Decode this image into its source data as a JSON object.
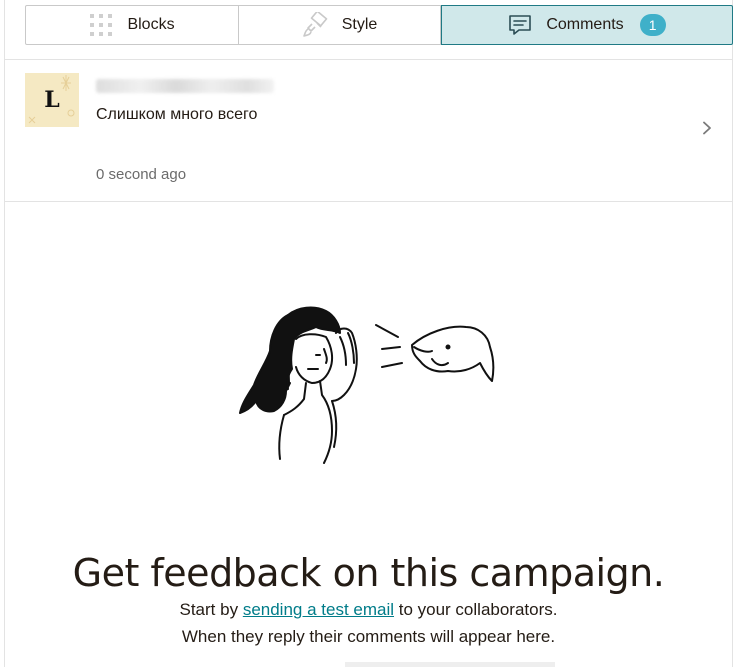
{
  "tabs": [
    {
      "label": "Blocks",
      "icon": "grid-dots-icon",
      "active": false
    },
    {
      "label": "Style",
      "icon": "paint-brush-icon",
      "active": false
    },
    {
      "label": "Comments",
      "icon": "comment-icon",
      "active": true,
      "badge": "1"
    }
  ],
  "comment": {
    "avatar_initial": "L",
    "text": "Слишком много всего",
    "time": "0 second ago",
    "chevron_icon": "chevron-right-icon"
  },
  "empty_state": {
    "illustration": "person-listening-to-dog-illustration",
    "title": "Get feedback on this campaign.",
    "line1_before": "Start by ",
    "line1_link": "sending a test email",
    "line1_after": " to your collaborators.",
    "line2": "When they reply their comments will appear here."
  },
  "colors": {
    "active_tab_bg": "#d0e8ea",
    "active_tab_border": "#1f7a85",
    "badge": "#3fb0c9",
    "link": "#007c89",
    "avatar_bg": "#f5e9c3"
  }
}
